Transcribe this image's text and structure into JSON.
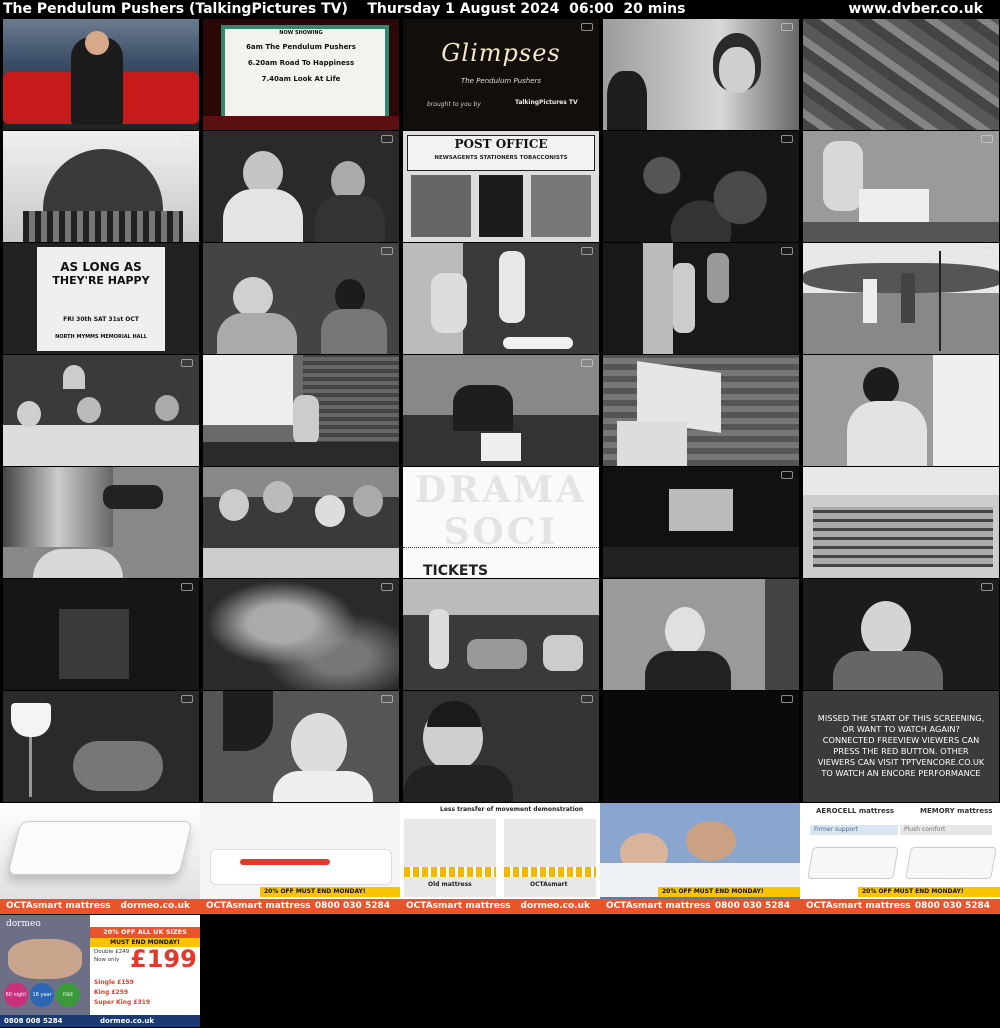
{
  "header": {
    "title": "The Pendulum Pushers (TalkingPictures TV)    Thursday 1 August 2024  06:00  20 mins",
    "site": "www.dvber.co.uk"
  },
  "thumbs": {
    "t2": {
      "lines": [
        "NOW SHOWING",
        "6am The Pendulum Pushers",
        "6.20am Road To Happiness",
        "7.40am Look At Life"
      ]
    },
    "t3": {
      "brand": "Glimpses",
      "sub": "The Pendulum Pushers",
      "credit": "brought to you by",
      "channel": "TalkingPictures TV"
    },
    "t8": {
      "sign": "POST OFFICE",
      "sub": "NEWSAGENTS  STATIONERS  TOBACCONISTS"
    },
    "t11": {
      "lines": [
        "AS LONG AS",
        "THEY'RE HAPPY",
        "FRI 30th SAT 31st OCT",
        "NORTH MYMMS MEMORIAL HALL"
      ]
    },
    "t23": {
      "text": "DRAMA SOCI",
      "tickets": "TICKETS"
    },
    "t35": {
      "lines": [
        "MISSED THE START OF THIS SCREENING,",
        "OR WANT TO WATCH AGAIN?",
        "CONNECTED FREEVIEW VIEWERS CAN",
        "PRESS THE RED BUTTON. OTHER",
        "VIEWERS CAN VISIT TPTVENCORE.CO.UK",
        "TO WATCH AN ENCORE PERFORMANCE"
      ]
    },
    "ads": {
      "brand": "OCTAsmart mattress",
      "site": "dormeo.co.uk",
      "phone": "0800 030 5284",
      "offer": "20% OFF  MUST END MONDAY!",
      "a3_title": "Less transfer of movement demonstration",
      "a3_old": "Old mattress",
      "a3_new": "OCTAsmart",
      "a5_left": "AEROCELL mattress",
      "a5_left_sub": "Firmer support",
      "a5_right": "MEMORY mattress",
      "a5_right_sub": "Plush comfort"
    },
    "final": {
      "brand": "dormeo",
      "offer1": "20% OFF ALL UK SIZES",
      "offer2": "MUST END MONDAY!",
      "was": "Double £249",
      "now": "Now only",
      "price": "£199",
      "sizes": [
        "Single £159",
        "King £259",
        "Super King £319"
      ],
      "badges": [
        "60 night",
        "18 year",
        "FREE delivery"
      ],
      "phone": "0808 008 5284",
      "site": "dormeo.co.uk"
    }
  },
  "colors": {
    "ad_orange": "#e8552a",
    "bg": "#000000",
    "text": "#ffffff"
  }
}
